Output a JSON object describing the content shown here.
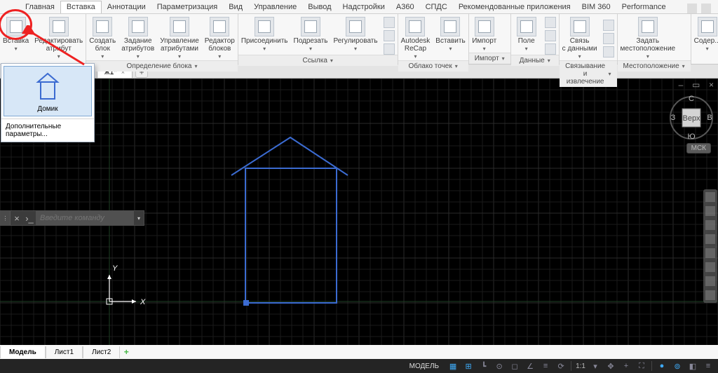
{
  "menubar": [
    "Главная",
    "Вставка",
    "Аннотации",
    "Параметризация",
    "Вид",
    "Управление",
    "Вывод",
    "Надстройки",
    "A360",
    "СПДС",
    "Рекомендованные приложения",
    "BIM 360",
    "Performance"
  ],
  "menubar_active_index": 1,
  "ribbon": {
    "panels": [
      {
        "title": "",
        "items": [
          {
            "label": "Вставка",
            "sp": 42
          },
          {
            "label": "Редактировать\nатрибут",
            "sp": 60
          }
        ]
      },
      {
        "title": "Определение блока",
        "items": [
          {
            "label": "Создать\nблок"
          },
          {
            "label": "Задание\nатрибутов"
          },
          {
            "label": "Управление\nатрибутами"
          },
          {
            "label": "Редактор\nблоков"
          }
        ]
      },
      {
        "title": "Ссылка",
        "items": [
          {
            "label": "Присоединить"
          },
          {
            "label": "Подрезать"
          },
          {
            "label": "Регулировать"
          }
        ],
        "small": true
      },
      {
        "title": "Облако точек",
        "items": [
          {
            "label": "Autodesk\nReCap"
          },
          {
            "label": "Вставить"
          }
        ]
      },
      {
        "title": "Импорт",
        "items": [
          {
            "label": "Импорт"
          }
        ]
      },
      {
        "title": "Данные",
        "items": [
          {
            "label": "Поле"
          }
        ],
        "small": true
      },
      {
        "title": "Связывание и извлечение",
        "items": [
          {
            "label": "Связь\nс данными"
          }
        ],
        "small": true
      },
      {
        "title": "Местоположение",
        "items": [
          {
            "label": "Задать\nместоположение"
          }
        ]
      },
      {
        "title": "",
        "items": [
          {
            "label": "Содер..."
          }
        ]
      }
    ]
  },
  "filetab": {
    "name": "ж1*"
  },
  "popup": {
    "item": "Домик",
    "more": "Дополнительные параметры..."
  },
  "cmd": {
    "placeholder": "Введите команду"
  },
  "cube": {
    "top": "Верх",
    "n": "С",
    "s": "Ю",
    "w": "З",
    "e": "В",
    "wcs": "МСК"
  },
  "mtabs": [
    "Модель",
    "Лист1",
    "Лист2"
  ],
  "status": {
    "model": "МОДЕЛЬ",
    "scale": "1:1"
  }
}
